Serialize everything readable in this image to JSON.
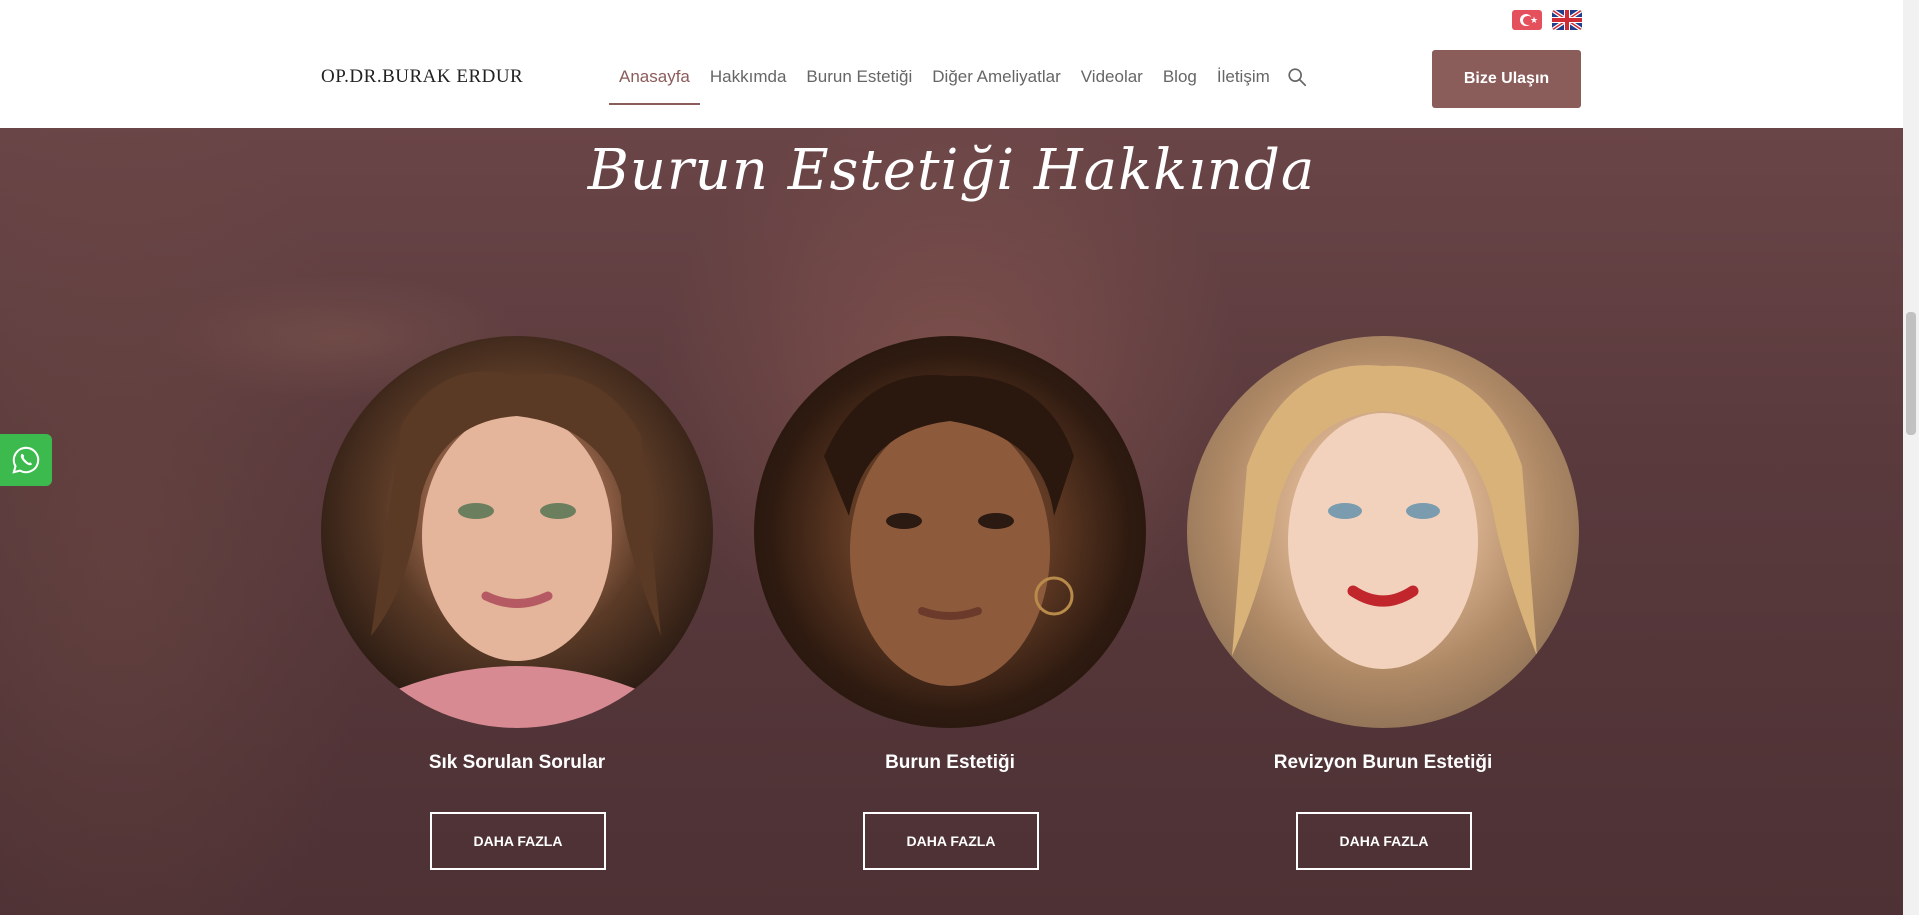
{
  "header": {
    "logo": "OP.DR.BURAK ERDUR",
    "nav": [
      {
        "label": "Anasayfa"
      },
      {
        "label": "Hakkımda"
      },
      {
        "label": "Burun Estetiği"
      },
      {
        "label": "Diğer Ameliyatlar"
      },
      {
        "label": "Videolar"
      },
      {
        "label": "Blog"
      },
      {
        "label": "İletişim"
      }
    ],
    "cta_label": "Bize Ulaşın",
    "languages": [
      "tr-flag-icon",
      "gb-flag-icon"
    ],
    "accent_color": "#8a5c5a"
  },
  "section": {
    "title": "Burun Estetiği Hakkında",
    "cards": [
      {
        "title": "Sık Sorulan Sorular",
        "button": "DAHA FAZLA"
      },
      {
        "title": "Burun Estetiği",
        "button": "DAHA FAZLA"
      },
      {
        "title": "Revizyon Burun Estetiği",
        "button": "DAHA FAZLA"
      }
    ]
  },
  "widgets": {
    "whatsapp_icon": "whatsapp-icon",
    "whatsapp_color": "#3dba4e"
  }
}
